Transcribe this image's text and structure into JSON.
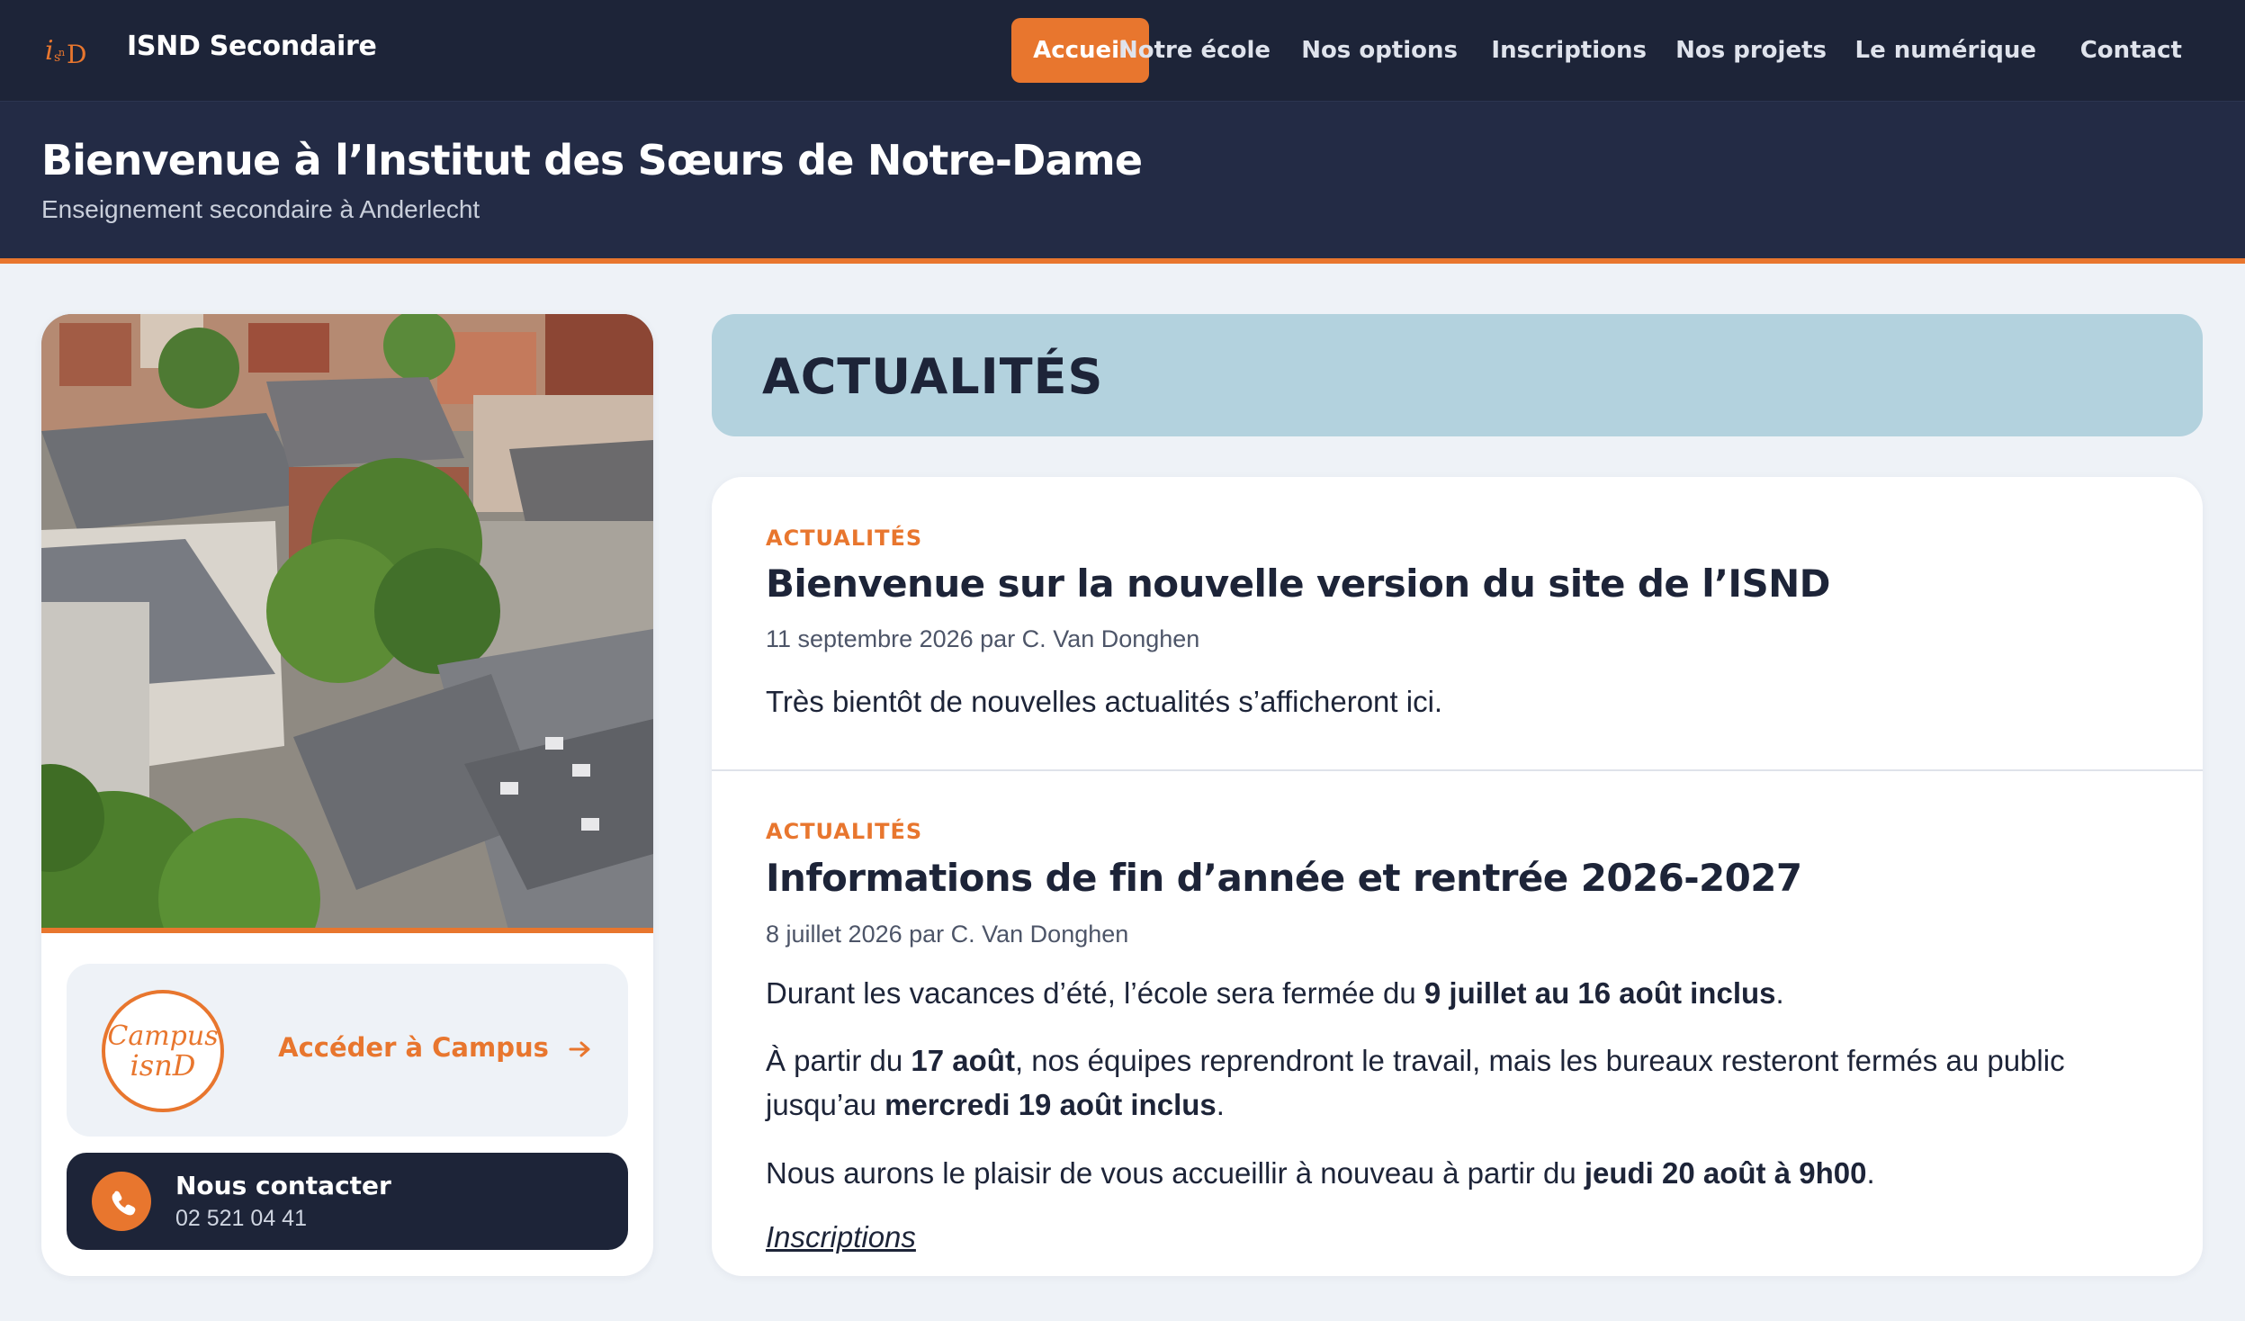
{
  "header": {
    "site_name": "ISND Secondaire",
    "logo_text": "isnD",
    "nav": [
      {
        "label": "Accueil",
        "active": true
      },
      {
        "label": "Notre école",
        "active": false
      },
      {
        "label": "Nos options",
        "active": false
      },
      {
        "label": "Inscriptions",
        "active": false
      },
      {
        "label": "Nos projets",
        "active": false
      },
      {
        "label": "Le numérique",
        "active": false
      },
      {
        "label": "Contact",
        "active": false
      }
    ]
  },
  "hero": {
    "title": "Bienvenue à l’Institut des Sœurs de Notre-Dame",
    "subtitle": "Enseignement secondaire à Anderlecht"
  },
  "sidebar": {
    "photo_icon": "aerial-school-photo",
    "campus": {
      "logo_text_1": "Campus",
      "logo_text_2": "isnD",
      "link_label": "Accéder à Campus",
      "link_icon": "arrow-right-icon"
    },
    "contact": {
      "icon": "phone-icon",
      "title": "Nous contacter",
      "phone": "02 521 04 41"
    }
  },
  "news": {
    "section_title": "ACTUALITÉS",
    "articles": [
      {
        "category": "ACTUALITÉS",
        "title": "Bienvenue sur la nouvelle version du site de l’ISND",
        "meta": "11 septembre 2026 par C. Van Donghen",
        "body": "Très bientôt de nouvelles actualités s’afficheront ici."
      },
      {
        "category": "ACTUALITÉS",
        "title": "Informations de fin d’année et rentrée 2026-2027",
        "meta": "8 juillet 2026 par C. Van Donghen",
        "p1": {
          "before": "Durant les vacances d’été, l’école sera fermée du ",
          "bold": "9 juillet au 16 août inclus",
          "after": "."
        },
        "p2": {
          "before": "À partir du ",
          "bold1": "17 août",
          "middle": ", nos équipes reprendront le travail, mais les bureaux resteront fermés au public jusqu’au ",
          "bold2": "mercredi 19 août inclus",
          "after": "."
        },
        "p3": {
          "before": "Nous aurons le plaisir de vous accueillir à nouveau à partir du ",
          "bold": "jeudi 20 août à 9h00",
          "after": "."
        },
        "link": "Inscriptions"
      }
    ]
  },
  "colors": {
    "navy": "#1d2438",
    "hero": "#232b45",
    "accent": "#e8762e",
    "section_head": "#b3d2de",
    "page_bg": "#eef2f7"
  }
}
